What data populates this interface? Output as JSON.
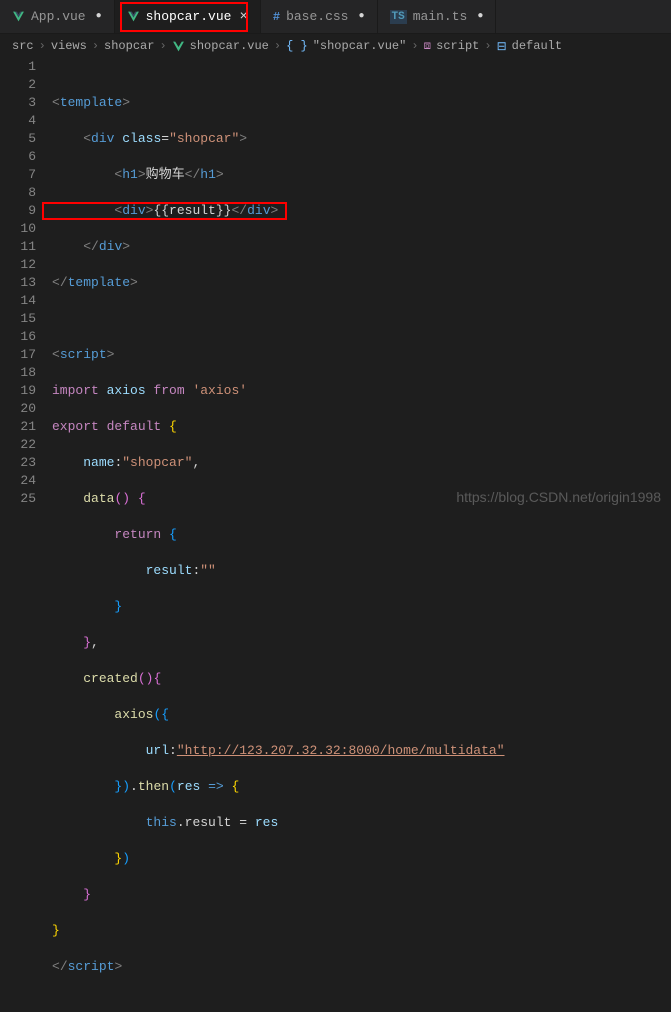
{
  "tabs": {
    "t0": {
      "label": "App.vue",
      "icon": "vue"
    },
    "t1": {
      "label": "shopcar.vue",
      "icon": "vue",
      "active": true
    },
    "t2": {
      "label": "base.css",
      "prefix": "#"
    },
    "t3": {
      "label": "main.ts",
      "prefix": "TS"
    }
  },
  "breadcrumb": {
    "b0": "src",
    "b1": "views",
    "b2": "shopcar",
    "b3": "shopcar.vue",
    "b4": "{ }",
    "b5": "\"shopcar.vue\"",
    "b6": "script",
    "b7": "default"
  },
  "lines": {
    "n1": "1",
    "n2": "2",
    "n3": "3",
    "n4": "4",
    "n5": "5",
    "n6": "6",
    "n7": "7",
    "n8": "8",
    "n9": "9",
    "n10": "10",
    "n11": "11",
    "n12": "12",
    "n13": "13",
    "n14": "14",
    "n15": "15",
    "n16": "16",
    "n17": "17",
    "n18": "18",
    "n19": "19",
    "n20": "20",
    "n21": "21",
    "n22": "22",
    "n23": "23",
    "n24": "24",
    "n25": "25"
  },
  "code": {
    "template_open_lt": "<",
    "template": "template",
    "gt": ">",
    "gt_close": "/",
    "div": "div",
    "class_attr": "class",
    "eq": "=",
    "shopcar_str": "\"shopcar\"",
    "h1": "h1",
    "h1_text": "购物车",
    "mustache": "{{result}}",
    "script_tag": "script",
    "import": "import ",
    "axios": "axios ",
    "from": "from ",
    "axios_pkg": "'axios'",
    "export": "export ",
    "default": "default ",
    "lbrace": "{",
    "rbrace": "}",
    "name_k": "name",
    "colon": ":",
    "shopcar_name": "\"shopcar\"",
    "comma": ",",
    "data_fn": "data",
    "paren": "()",
    "space": " ",
    "return": "return ",
    "result_k": "result",
    "empty": "\"\"",
    "created_fn": "created",
    "axios_call": "axios",
    "lparen": "(",
    "rparen": ")",
    "url_k": "url",
    "url_v": "\"http://123.207.32.32:8000/home/multidata\"",
    "dot": ".",
    "then": "then",
    "res": "res",
    "arrow": " => ",
    "this": "this",
    "result_p": ".result = ",
    "res_v": "res"
  },
  "watermark": "https://blog.CSDN.net/origin1998"
}
